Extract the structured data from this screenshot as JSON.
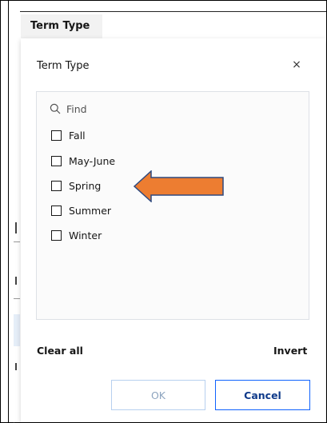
{
  "tab": {
    "label": "Term Type"
  },
  "dialog": {
    "title": "Term Type",
    "close_icon": "close-icon",
    "close_glyph": "×"
  },
  "search": {
    "placeholder": "Find",
    "value": ""
  },
  "options": [
    {
      "label": "Fall",
      "checked": false
    },
    {
      "label": "May-June",
      "checked": false
    },
    {
      "label": "Spring",
      "checked": false
    },
    {
      "label": "Summer",
      "checked": false
    },
    {
      "label": "Winter",
      "checked": false
    }
  ],
  "annotation": {
    "icon": "arrow-left-icon",
    "color": "#ed7d31",
    "outline": "#2f4a7f"
  },
  "actions": {
    "clear_all": "Clear all",
    "invert": "Invert",
    "ok": "OK",
    "cancel": "Cancel"
  }
}
